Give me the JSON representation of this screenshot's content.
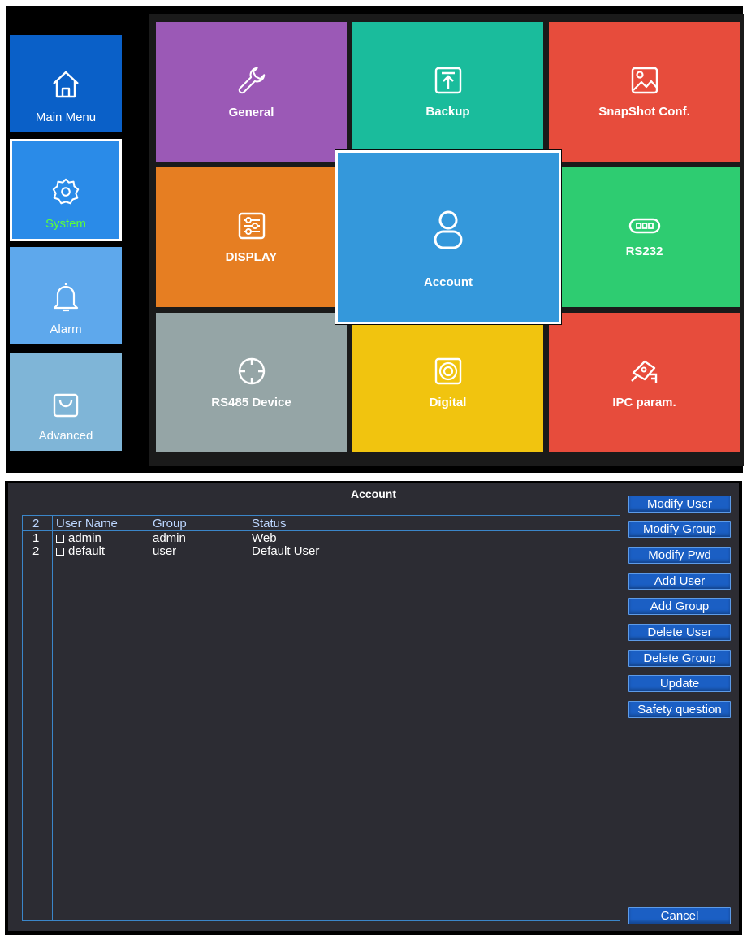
{
  "sidebar": {
    "items": [
      {
        "label": "Main Menu",
        "icon": "home-icon",
        "color": "#0a60c8"
      },
      {
        "label": "System",
        "icon": "gear-icon",
        "color": "#2a8be8",
        "selected": true,
        "label_color": "#5bff3a"
      },
      {
        "label": "Alarm",
        "icon": "bell-icon",
        "color": "#5ea8ec"
      },
      {
        "label": "Advanced",
        "icon": "bag-icon",
        "color": "#7fb5d7"
      }
    ]
  },
  "tiles": [
    {
      "label": "General",
      "icon": "wrench-icon",
      "color": "#9b59b6"
    },
    {
      "label": "Backup",
      "icon": "upload-icon",
      "color": "#1abc9c"
    },
    {
      "label": "SnapShot Conf.",
      "icon": "image-icon",
      "color": "#e74c3c"
    },
    {
      "label": "DISPLAY",
      "icon": "sliders-icon",
      "color": "#e67e22"
    },
    {
      "label": "Account",
      "icon": "user-icon",
      "color": "#3498db",
      "focused": true
    },
    {
      "label": "RS232",
      "icon": "serial-port-icon",
      "color": "#2ecc71"
    },
    {
      "label": "RS485 Device",
      "icon": "crosshair-icon",
      "color": "#95a5a6"
    },
    {
      "label": "Digital",
      "icon": "speaker-icon",
      "color": "#f1c40f"
    },
    {
      "label": "IPC param.",
      "icon": "camera-icon",
      "color": "#e74c3c"
    }
  ],
  "dialog": {
    "title": "Account",
    "table": {
      "count": "2",
      "columns": [
        "User Name",
        "Group",
        "Status"
      ],
      "rows": [
        {
          "index": "1",
          "name": "admin",
          "group": "admin",
          "status": "Web"
        },
        {
          "index": "2",
          "name": "default",
          "group": "user",
          "status": "Default User"
        }
      ]
    },
    "buttons": [
      "Modify User",
      "Modify Group",
      "Modify Pwd",
      "Add User",
      "Add Group",
      "Delete User",
      "Delete Group",
      "Update",
      "Safety question"
    ],
    "cancel_label": "Cancel"
  }
}
